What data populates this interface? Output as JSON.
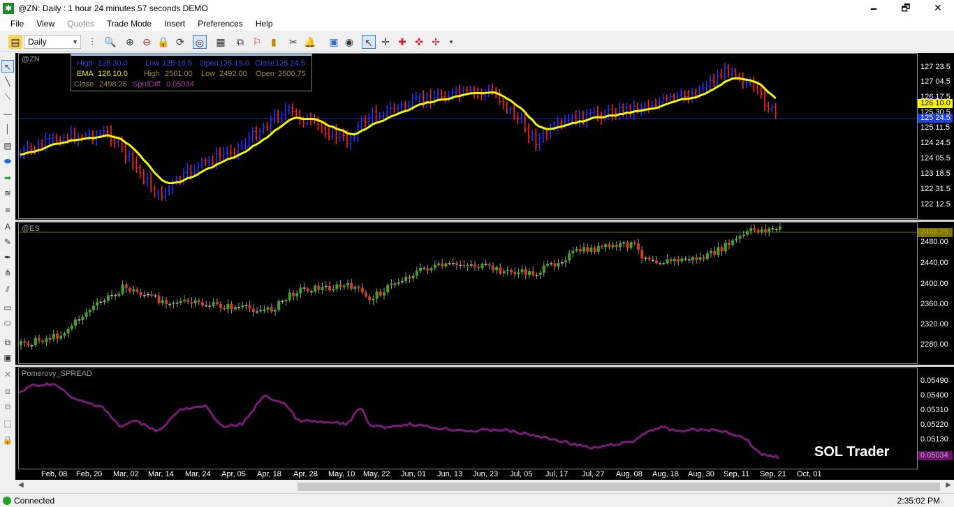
{
  "window": {
    "title": "@ZN: Daily : 1 hour 24 minutes 57 seconds DEMO",
    "minimize": "🗕",
    "maximize": "🗗",
    "close": "✕"
  },
  "menu": [
    {
      "label": "File",
      "enabled": true
    },
    {
      "label": "View",
      "enabled": true
    },
    {
      "label": "Quotes",
      "enabled": false
    },
    {
      "label": "Trade Mode",
      "enabled": true
    },
    {
      "label": "Insert",
      "enabled": true
    },
    {
      "label": "Preferences",
      "enabled": true
    },
    {
      "label": "Help",
      "enabled": true
    }
  ],
  "toolbar": {
    "interval_value": "Daily",
    "icons": [
      "workspace-icon",
      "bar-type-icon",
      "magnifier-icon",
      "zoom-in-icon",
      "zoom-out-icon",
      "lock-icon",
      "refresh-icon",
      "data-window-icon",
      "format-icon",
      "hierarchy-icon",
      "trading-icon",
      "chart-type-icon",
      "scissors-icon",
      "alert-bell-icon",
      "book-icon",
      "eye-icon",
      "pointer-icon",
      "crosshair-icon",
      "cross-icon",
      "red-cross-icon",
      "red-arrow-cross-icon",
      "overflow-icon"
    ]
  },
  "drawing_tools": [
    "pointer-tool-icon",
    "line-tool-icon",
    "ray-tool-icon",
    "parallel-line-icon",
    "horizontal-line-icon",
    "vertical-line-icon",
    "text-note-icon",
    "callout-icon",
    "arrow-tool-icon",
    "wave-tool-icon",
    "fibonacci-tool-icon",
    "text-tool-icon",
    "pencil-tool-icon",
    "pen-tool-icon",
    "fork-tool-icon",
    "angle-tool-icon",
    "speed-lines-icon",
    "rectangle-tool-icon",
    "ellipse-tool-icon",
    "stack-icon",
    "image-tool-icon",
    "delete-icon",
    "objects-icon",
    "copy-objects-icon",
    "select-area-icon",
    "lock-objects-icon"
  ],
  "panes": {
    "zn": {
      "symbol": "@ZN",
      "y_labels": [
        "127 23.5",
        "127 04.5",
        "126 17.5",
        "125 30.5",
        "125 11.5",
        "124 24.5",
        "124 05.5",
        "123 18.5",
        "122 31.5",
        "122 12.5"
      ],
      "current_tag": {
        "text": "125 24.5",
        "bg": "#1f3fd8",
        "fg": "#ffffff"
      },
      "ema_tag": {
        "text": "126 10.0",
        "bg": "#f5f500",
        "fg": "#000000"
      },
      "reference_line_value": "125 24.5"
    },
    "es": {
      "symbol": "@ES",
      "y_labels": [
        "2480.00",
        "2440.00",
        "2400.00",
        "2360.00",
        "2320.00",
        "2280.00"
      ],
      "last_tag": {
        "text": "2498.25",
        "bg": "#7e7400",
        "fg": "#b9a000"
      }
    },
    "spread": {
      "name": "Pomerovy_SPREAD",
      "y_labels": [
        "0.05490",
        "0.05400",
        "0.05310",
        "0.05220",
        "0.05130"
      ],
      "last_tag": {
        "text": "0.05034",
        "bg": "#6a0f6a",
        "fg": "#d8a0d8"
      },
      "line_color": "#7a1a7a"
    }
  },
  "infobox": {
    "row1": {
      "high_label": "High",
      "high_value": "125 30.0",
      "low_label": "Low",
      "low_value": "125 18.5",
      "open_label": "Open",
      "open_value": "125 19.0",
      "close_label": "Close",
      "close_value": "125 24.5"
    },
    "row2": {
      "ema_label": "EMA",
      "ema_value": "126 10.0",
      "high_label": "High",
      "high_value": "2501.00",
      "low_label": "Low",
      "low_value": "2492.00",
      "open_label": "Open",
      "open_value": "2500.75"
    },
    "row3": {
      "close_label": "Close",
      "close_value": "2498.25",
      "spread_label": "SprdDiff",
      "spread_value": "0.05034"
    }
  },
  "x_axis_labels": [
    "Feb, 08",
    "Feb, 20",
    "Mar, 02",
    "Mar, 14",
    "Mar, 24",
    "Apr, 05",
    "Apr, 18",
    "Apr, 28",
    "May, 10",
    "May, 22",
    "Jun, 01",
    "Jun, 13",
    "Jun, 23",
    "Jul, 05",
    "Jul, 17",
    "Jul, 27",
    "Aug, 08",
    "Aug, 18",
    "Aug, 30",
    "Sep, 11",
    "Sep, 21",
    "Oct, 01"
  ],
  "watermark": "SOL Trader",
  "status": {
    "connection": "Connected",
    "time": "2:35:02 PM"
  },
  "colors": {
    "zn_up": "#2d2dff",
    "zn_down": "#ff2020",
    "ema": "#f5f500",
    "es_up": "#43a51f",
    "es_down": "#d63a1a",
    "es_doji": "#c7b07a",
    "spread": "#7a1a7a",
    "reference_line": "#1a28c8"
  }
}
